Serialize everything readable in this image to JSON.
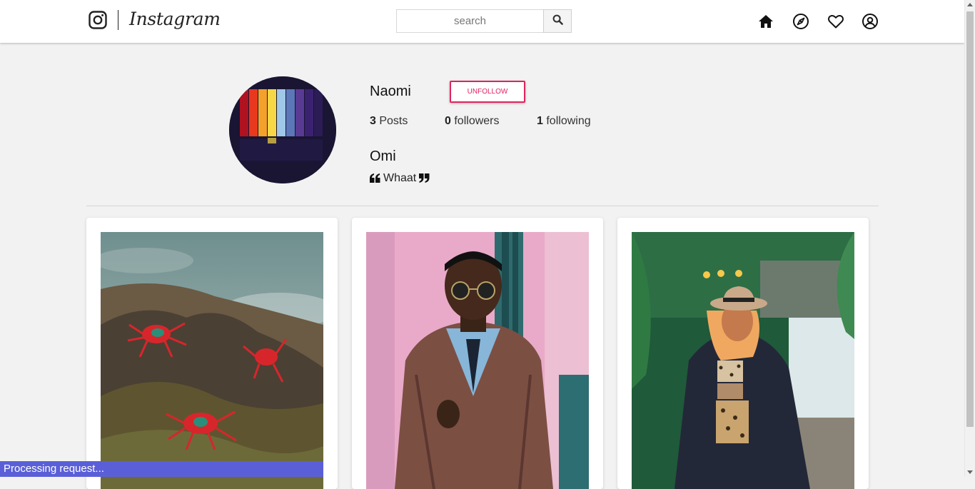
{
  "navbar": {
    "logo_text": "Instagram",
    "search": {
      "placeholder": "search"
    },
    "icons": [
      "home-icon",
      "compass-icon",
      "heart-icon",
      "user-circle-icon"
    ]
  },
  "profile": {
    "username": "Naomi",
    "unfollow_label": "UNFOLLOW",
    "stats": {
      "posts_count": "3",
      "posts_label": "Posts",
      "followers_count": "0",
      "followers_label": "followers",
      "following_count": "1",
      "following_label": "following"
    },
    "full_name": "Omi",
    "bio": "Whaat"
  },
  "posts": [
    {
      "subject": "red crabs on rocks"
    },
    {
      "subject": "man in sunglasses and brown leather jacket"
    },
    {
      "subject": "woman in hat and fur coat"
    }
  ],
  "status": {
    "text": "Processing request..."
  },
  "colors": {
    "accent": "#e0245e",
    "status_bar": "#5a5fd8",
    "page_bg": "#f2f2f2"
  }
}
